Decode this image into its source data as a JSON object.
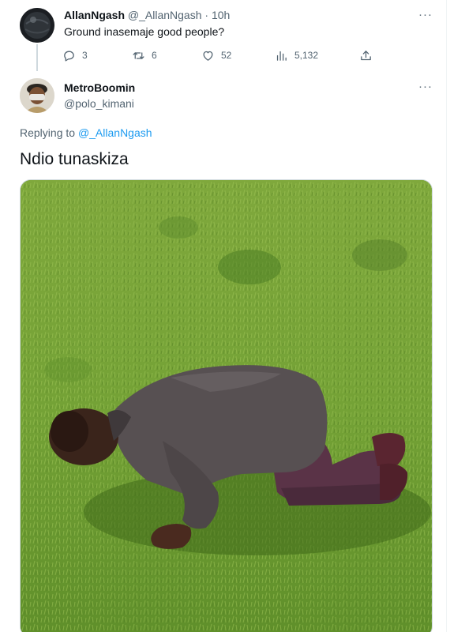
{
  "parent_tweet": {
    "name": "AllanNgash",
    "handle": "@_AllanNgash",
    "separator": "·",
    "time": "10h",
    "text": "Ground inasemaje good people?",
    "more": "···",
    "stats": {
      "replies": "3",
      "retweets": "6",
      "likes": "52",
      "views": "5,132"
    },
    "icons": [
      "reply-icon",
      "retweet-icon",
      "like-icon",
      "views-icon",
      "share-icon"
    ]
  },
  "reply_tweet": {
    "name": "MetroBoomin",
    "handle": "@polo_kimani",
    "more": "···",
    "replying_prefix": "Replying to",
    "replying_to": "@_AllanNgash",
    "text": "Ndio tunaskiza"
  },
  "colors": {
    "link": "#1d9bf0",
    "secondary_text": "#536471",
    "primary_text": "#0f1419",
    "thread_line": "#cfd9de"
  }
}
